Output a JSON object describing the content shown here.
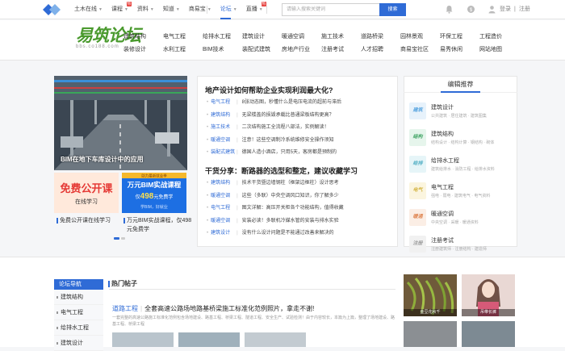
{
  "topbar": {
    "nav": [
      {
        "label": "土木在线",
        "caret": true,
        "hot": false,
        "active": false
      },
      {
        "label": "课程",
        "caret": true,
        "hot": true,
        "active": false
      },
      {
        "label": "资料",
        "caret": true,
        "hot": false,
        "active": false
      },
      {
        "label": "知道",
        "caret": true,
        "hot": false,
        "active": false
      },
      {
        "label": "商易宝",
        "caret": true,
        "hot": false,
        "active": false
      },
      {
        "label": "论坛",
        "caret": true,
        "hot": false,
        "active": true
      },
      {
        "label": "直播",
        "caret": true,
        "hot": true,
        "active": false
      }
    ],
    "hot_badge": "热",
    "search_placeholder": "请输入搜索关键词",
    "search_button": "搜索",
    "login": "登录",
    "register": "注册",
    "divider": "|"
  },
  "header": {
    "logo_cn": "易筑论坛",
    "logo_en": "bbs.co188.com",
    "categories_row1": [
      "建筑结构",
      "电气工程",
      "给排水工程",
      "建筑设计",
      "暖通空调",
      "施工技术",
      "道路桥梁",
      "园林景观",
      "环保工程",
      "工程造价"
    ],
    "categories_row2": [
      "装修设计",
      "水利工程",
      "BIM技术",
      "装配式建筑",
      "房地产行业",
      "注册考试",
      "人才招聘",
      "商易宝社区",
      "易秀休闲",
      "网站地图"
    ]
  },
  "banner": {
    "caption": "BIM在地下车库设计中的应用"
  },
  "promos": [
    {
      "title": "免费公开课",
      "subtitle": "在线学习",
      "caption": "免费公开课在线学习",
      "color": "#e53935"
    },
    {
      "top": "助力最新就业季",
      "title": "万元BIM实战课程",
      "price_prefix": "仅",
      "price": "498",
      "price_suffix": "元免费学",
      "bottom": "学BIM，好就业",
      "caption": "万元BIM实战课程，仅498元免费学",
      "color": "#1d6fe3"
    }
  ],
  "middle": {
    "section1_title": "地产设计如何帮助企业实现利润最大化?",
    "section1_items": [
      {
        "cat": "电气工程",
        "text": "8张动态图，秒懂什么是电压电流的超前与滞后"
      },
      {
        "cat": "建筑结构",
        "text": "无梁楼盖的损毁承载比普通梁板结构更高？"
      },
      {
        "cat": "施工技术",
        "text": "二次结构施工全流程八部法，实例解读！"
      },
      {
        "cat": "暖通空调",
        "text": "注意！这些空调制冷系统维修安全操作须知"
      },
      {
        "cat": "装配式建筑",
        "text": "德国人造小酒店，只用5天，客房都是预制的"
      }
    ],
    "section2_title": "干货分享：断路器的选型和整定，建议收藏学习",
    "section2_items": [
      {
        "cat": "建筑结构",
        "text": "技术干货暨边墙钢柱（框架边框柱）设计思考"
      },
      {
        "cat": "暖通空调",
        "text": "这些（多联）中央空调风口知识，你了解多少"
      },
      {
        "cat": "电气工程",
        "text": "图文详解：高压开关柜各个功能结构，值得收藏"
      },
      {
        "cat": "暖通空调",
        "text": "安装必读！多联机冷媒水管的安装与排水实验"
      },
      {
        "cat": "建筑设计",
        "text": "没有什么设计问题是不能通过改善来解决的"
      }
    ]
  },
  "right": {
    "title": "编辑推荐",
    "items": [
      {
        "icon": "建筑",
        "name": "建筑设计",
        "tags": "公共建筑 · 居住建筑 · 建筑图集",
        "color": "#5aa6e0",
        "bg": "#e7f2fb"
      },
      {
        "icon": "结构",
        "name": "建筑结构",
        "tags": "结构设计 · 结构计算 · 钢结构 · 砌体",
        "color": "#49a86b",
        "bg": "#e6f5ec"
      },
      {
        "icon": "给排",
        "name": "给排水工程",
        "tags": "建筑给排水 · 消防工程 · 给排水资料",
        "color": "#56b1c6",
        "bg": "#e6f5f8"
      },
      {
        "icon": "电气",
        "name": "电气工程",
        "tags": "强电 · 弱电 · 建筑电气 · 电气资料",
        "color": "#d5b646",
        "bg": "#fbf5df"
      },
      {
        "icon": "暖通",
        "name": "暖通空调",
        "tags": "中央空调 · 采暖 · 暖通资料",
        "color": "#e08a58",
        "bg": "#fbeee5"
      },
      {
        "icon": "注册",
        "name": "注册考试",
        "tags": "注册建筑师 · 注册结构 · 建造师",
        "color": "#999999",
        "bg": "#f1f1f1"
      }
    ]
  },
  "forum_nav": {
    "title": "论坛导航",
    "items": [
      "建筑结构",
      "电气工程",
      "给排水工程",
      "建筑设计"
    ]
  },
  "hot_posts": {
    "title": "热门帖子",
    "article_cat": "道路工程",
    "article_bar": "|",
    "article_title": "全套高速公路场地路基桥梁施工标准化范例照片，拿走不谢!",
    "article_body": "一套完整的高速公路施工标准化范例包含场地建设、路基工程、桥梁工程、隧道工程、安全生产、试验检测！由于内容较长，本篇为上篇，整理了场地建设、路基工程、桥梁工程"
  },
  "gallery": [
    {
      "caption": "金豆花秋千"
    },
    {
      "caption": "吊带长裤"
    }
  ]
}
